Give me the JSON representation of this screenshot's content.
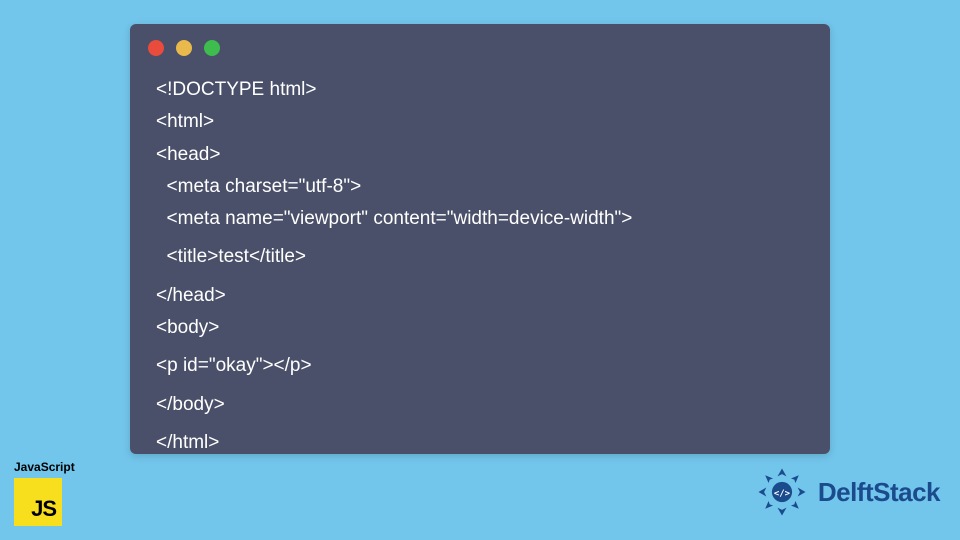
{
  "code": {
    "lines": [
      "<!DOCTYPE html>",
      "<html>",
      "<head>",
      "  <meta charset=\"utf-8\">",
      "  <meta name=\"viewport\" content=\"width=device-width\">",
      "  <title>test</title>",
      "</head>",
      "<body>",
      "<p id=\"okay\"></p>",
      "</body>",
      "</html>"
    ]
  },
  "badges": {
    "js_label": "JavaScript",
    "js_logo_text": "JS",
    "delft_text": "DelftStack"
  },
  "colors": {
    "page_bg": "#72c5eb",
    "window_bg": "#4a5069",
    "code_text": "#ffffff",
    "js_yellow": "#f7df1e",
    "delft_blue": "#1a4b8c"
  }
}
